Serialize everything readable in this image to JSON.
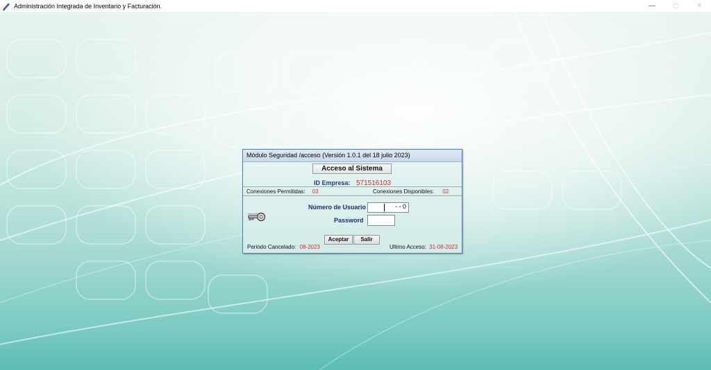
{
  "window": {
    "title": "Administración Integrada de Inventario y Facturación.",
    "icons": [
      "app-icon",
      "minimize-icon",
      "maximize-icon",
      "close-icon"
    ]
  },
  "dialog": {
    "title": "Módulo Seguridad /acceso (Versión 1.0.1 del 18 julio 2023)",
    "heading": "Acceso al Sistema",
    "id_label": "ID Empresa:",
    "id_value": "571516103",
    "conexiones_permitidas_label": "Conexiones Permitidas:",
    "conexiones_permitidas_value": "03",
    "conexiones_disponibles_label": "Conexiones Disponibles:",
    "conexiones_disponibles_value": "02",
    "usuario_label": "Número de Usuario",
    "usuario_value": "-  -  0",
    "password_label": "Password",
    "password_value": "",
    "aceptar": "Aceptar",
    "salir": "Salir",
    "periodo_label": "Periodo Cancelado:",
    "periodo_value": "08-2023",
    "ultimo_label": "Ultimo Acceso:",
    "ultimo_value": "31-08-2023",
    "key_icon": "key-icon"
  },
  "colors": {
    "label_blue": "#1c2f7c",
    "value_red": "#d22a2a",
    "dialog_border": "#4f7ea8",
    "background_teal": "#7ccbc3"
  }
}
